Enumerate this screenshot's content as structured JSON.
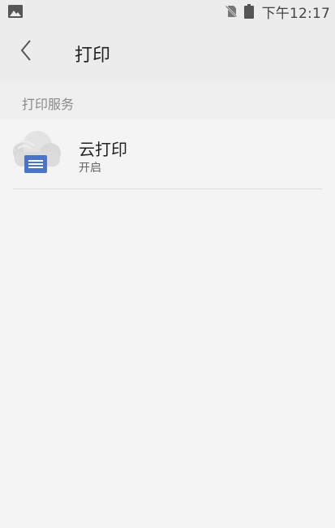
{
  "status_bar": {
    "time": "下午12:17",
    "icons": [
      "image-notification-icon",
      "no-sim-icon",
      "battery-icon"
    ]
  },
  "app_bar": {
    "title": "打印",
    "back_icon": "back-arrow-icon"
  },
  "section": {
    "header": "打印服务"
  },
  "print_services": [
    {
      "name": "云打印",
      "status": "开启",
      "icon": "cloud-print-icon"
    }
  ],
  "colors": {
    "background": "#f4f4f4",
    "app_bar": "#ececec",
    "accent_blue": "#4a74c9",
    "cloud": "#d9d9d9"
  }
}
